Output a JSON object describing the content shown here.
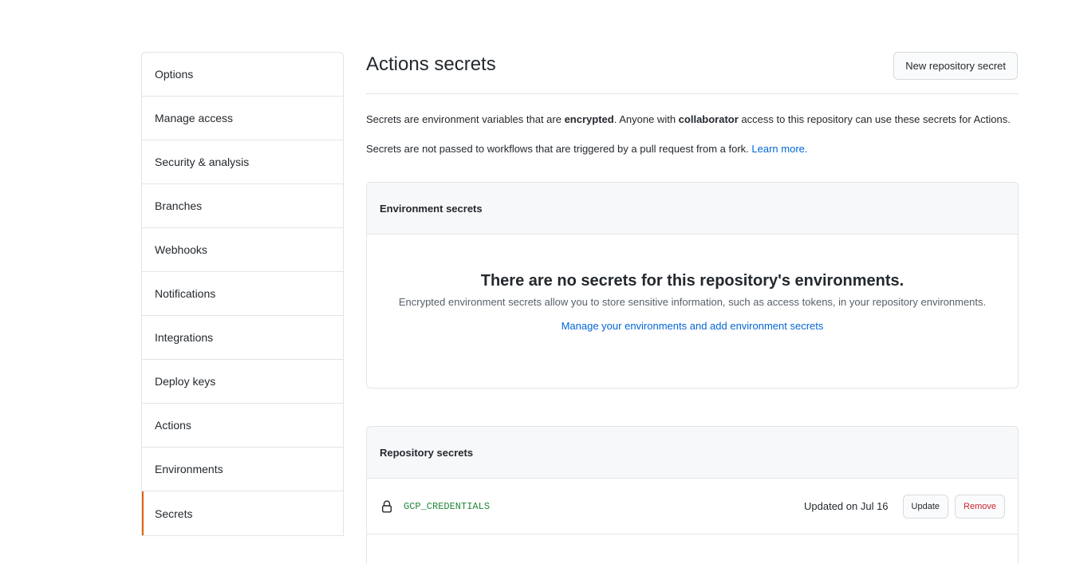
{
  "sidebar": {
    "items": [
      {
        "label": "Options"
      },
      {
        "label": "Manage access"
      },
      {
        "label": "Security & analysis"
      },
      {
        "label": "Branches"
      },
      {
        "label": "Webhooks"
      },
      {
        "label": "Notifications"
      },
      {
        "label": "Integrations"
      },
      {
        "label": "Deploy keys"
      },
      {
        "label": "Actions"
      },
      {
        "label": "Environments"
      },
      {
        "label": "Secrets",
        "selected": true
      }
    ]
  },
  "header": {
    "title": "Actions secrets",
    "new_secret_label": "New repository secret"
  },
  "intro": {
    "line1_a": "Secrets are environment variables that are ",
    "line1_b": "encrypted",
    "line1_c": ". Anyone with ",
    "line1_d": "collaborator",
    "line1_e": " access to this repository can use these secrets for Actions.",
    "line2": "Secrets are not passed to workflows that are triggered by a pull request from a fork. ",
    "learn_more": "Learn more."
  },
  "environment_secrets": {
    "header": "Environment secrets",
    "blank_title": "There are no secrets for this repository's environments.",
    "blank_desc": "Encrypted environment secrets allow you to store sensitive information, such as access tokens, in your repository environments.",
    "blank_link": "Manage your environments and add environment secrets"
  },
  "repository_secrets": {
    "header": "Repository secrets",
    "rows": [
      {
        "icon": "lock-icon",
        "name": "GCP_CREDENTIALS",
        "updated": "Updated on Jul 16",
        "update_label": "Update",
        "remove_label": "Remove"
      }
    ]
  },
  "colors": {
    "link": "#0366d6",
    "secret_name": "#22863a",
    "danger": "#cb2431",
    "selected_indicator": "#e36209"
  }
}
